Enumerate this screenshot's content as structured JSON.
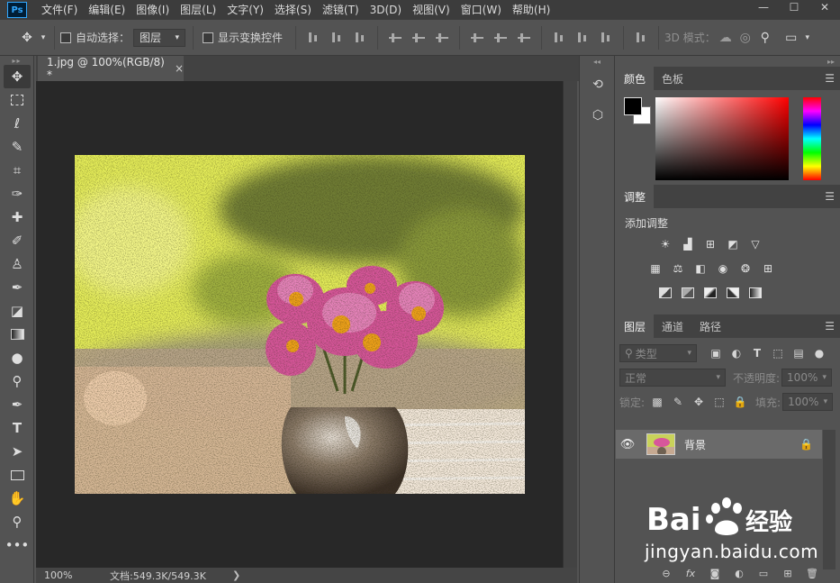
{
  "app": {
    "logo": "Ps"
  },
  "menu": [
    "文件(F)",
    "编辑(E)",
    "图像(I)",
    "图层(L)",
    "文字(Y)",
    "选择(S)",
    "滤镜(T)",
    "3D(D)",
    "视图(V)",
    "窗口(W)",
    "帮助(H)"
  ],
  "window_controls": {
    "minimize": "—",
    "restore": "☐",
    "close": "✕"
  },
  "options": {
    "auto_select_label": "自动选择：",
    "auto_select_value": "图层",
    "show_transform_label": "显示变换控件",
    "mode_3d_label": "3D 模式："
  },
  "document": {
    "tab_title": "1.jpg @ 100%(RGB/8) *",
    "close_glyph": "×",
    "zoom": "100%",
    "doc_info": "文档:549.3K/549.3K",
    "status_arrow": "❯"
  },
  "color_panel": {
    "tabs": [
      "颜色",
      "色板"
    ],
    "foreground": "#000000",
    "background": "#ffffff"
  },
  "adjust_panel": {
    "tab": "调整",
    "title": "添加调整"
  },
  "layers_panel": {
    "tabs": [
      "图层",
      "通道",
      "路径"
    ],
    "filter_kind": "类型",
    "blend_mode": "正常",
    "opacity_label": "不透明度:",
    "opacity_value": "100%",
    "lock_label": "锁定:",
    "fill_label": "填充:",
    "fill_value": "100%",
    "layer_name": "背景"
  },
  "watermark": {
    "brand": "Bai",
    "brand_cn": "经验",
    "url": "jingyan.baidu.com"
  }
}
